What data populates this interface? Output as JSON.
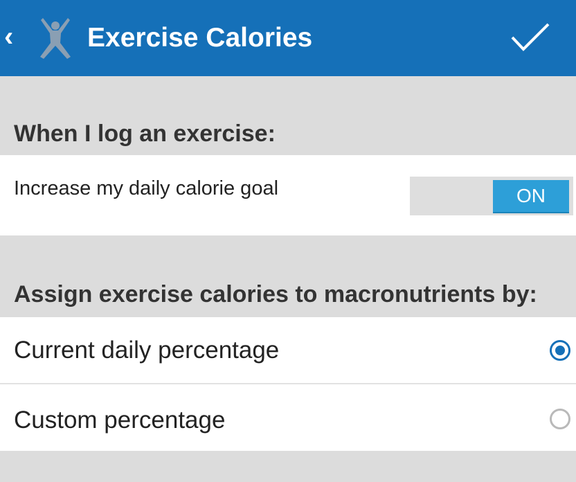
{
  "appbar": {
    "back_icon": "chevron-left-icon",
    "logo_icon": "jumping-person-logo",
    "title": "Exercise Calories",
    "confirm_icon": "checkmark-icon",
    "background": "#1570b8"
  },
  "exercise_log_section": {
    "header": "When I log an exercise:",
    "increase_goal": {
      "label": "Increase my daily calorie goal",
      "toggle_state": "ON",
      "toggle_color": "#2d9fd8"
    }
  },
  "macronutrient_section": {
    "header": "Assign exercise calories to macronutrients by:",
    "options": [
      {
        "label": "Current daily percentage",
        "selected": true
      },
      {
        "label": "Custom percentage",
        "selected": false
      }
    ]
  }
}
